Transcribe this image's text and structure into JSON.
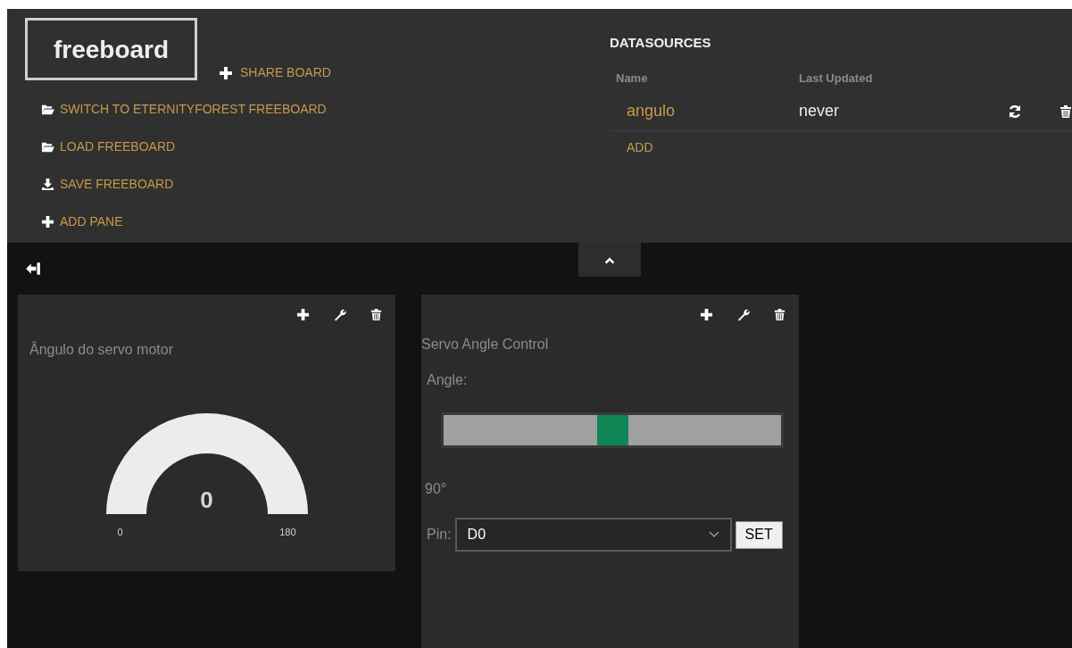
{
  "header": {
    "logo": "freeboard",
    "share": {
      "kind": "plus",
      "label": "SHARE BOARD"
    },
    "menu": [
      {
        "kind": "folder",
        "label": "SWITCH TO ETERNITYFOREST FREEBOARD"
      },
      {
        "kind": "folder",
        "label": "LOAD FREEBOARD"
      },
      {
        "kind": "download",
        "label": "SAVE FREEBOARD"
      },
      {
        "kind": "plus",
        "label": "ADD PANE"
      }
    ]
  },
  "datasources": {
    "title": "DATASOURCES",
    "columns": [
      "Name",
      "Last Updated"
    ],
    "rows": [
      {
        "name": "angulo",
        "last_updated": "never"
      }
    ],
    "add": "ADD"
  },
  "panes": [
    {
      "kind": "gauge",
      "title": "Ângulo do servo motor",
      "value": "0",
      "min": "0",
      "max": "180"
    },
    {
      "kind": "servo",
      "title": "Servo Angle Control",
      "label": "Angle:",
      "level": 0.5,
      "reading": "90°",
      "pin_label": "Pin:",
      "pin_value": "D0",
      "button": "SET"
    }
  ]
}
